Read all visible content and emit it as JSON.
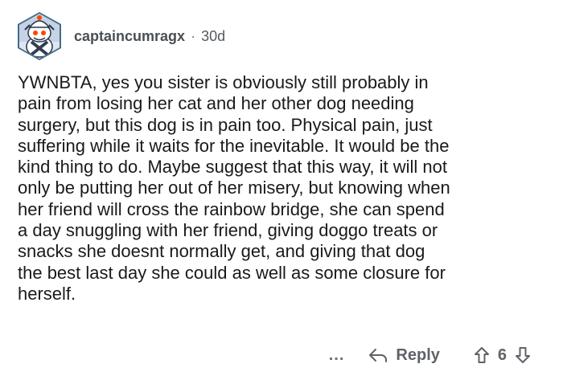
{
  "comment": {
    "username": "captaincumragx",
    "separator": "·",
    "age": "30d",
    "avatar_icon": "snoo-avatar-icon",
    "body_lines": [
      "YWNBTA, yes you sister is obviously still probably in",
      "pain from losing her cat and her other dog needing",
      "surgery, but this dog is in pain too. Physical pain, just",
      "suffering while it waits for the inevitable. It would be the",
      "kind thing to do. Maybe suggest that this way, it will not",
      "only be putting her out of her misery, but knowing when",
      "her friend will cross the rainbow bridge, she can spend",
      "a day snuggling with her friend, giving doggo treats or",
      "snacks she doesnt normally get, and giving that dog",
      "the best last day she could as well as some closure for",
      "herself."
    ]
  },
  "actions": {
    "more_label": "...",
    "reply_label": "Reply",
    "reply_icon": "reply-arrow-icon",
    "score": "6",
    "upvote_icon": "upvote-arrow-icon",
    "downvote_icon": "downvote-arrow-icon"
  },
  "colors": {
    "text": "#1a1a1b",
    "meta": "#555a5f",
    "action": "#5f6368",
    "avatar_border": "#3f6d8b",
    "avatar_bg": "#c7d2e5"
  }
}
